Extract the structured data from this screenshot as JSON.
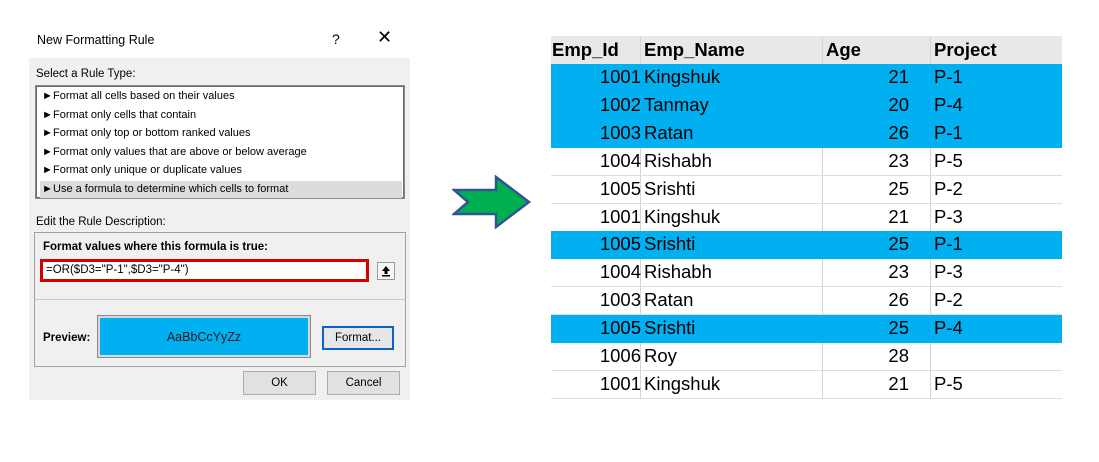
{
  "dialog": {
    "title": "New Formatting Rule",
    "help_label": "?",
    "close_label": "✕",
    "select_rule_type_label": "Select a Rule Type:",
    "rule_types": [
      {
        "label": "Format all cells based on their values",
        "selected": false
      },
      {
        "label": "Format only cells that contain",
        "selected": false
      },
      {
        "label": "Format only top or bottom ranked values",
        "selected": false
      },
      {
        "label": "Format only values that are above or below average",
        "selected": false
      },
      {
        "label": "Format only unique or duplicate values",
        "selected": false
      },
      {
        "label": "Use a formula to determine which cells to format",
        "selected": true
      }
    ],
    "rule_arrow": "►",
    "edit_description_label": "Edit the Rule Description:",
    "formula_heading": "Format values where this formula is true:",
    "formula_value": "=OR($D3=\"P-1\",$D3=\"P-4\")",
    "collapse_icon": "collapse-dialog-icon",
    "preview_label": "Preview:",
    "preview_text": "AaBbCcYyZz",
    "preview_color": "#00b0f0",
    "format_button": "Format...",
    "ok_button": "OK",
    "cancel_button": "Cancel"
  },
  "arrow": {
    "icon": "right-arrow-icon",
    "fill": "#00b050",
    "stroke": "#2f5597"
  },
  "table": {
    "headers": [
      "Emp_Id",
      "Emp_Name",
      "Age",
      "Project"
    ],
    "highlight_color": "#00b0f0",
    "rows": [
      {
        "id": "1001",
        "name": "Kingshuk",
        "age": "21",
        "project": "P-1",
        "highlight": true
      },
      {
        "id": "1002",
        "name": "Tanmay",
        "age": "20",
        "project": "P-4",
        "highlight": true
      },
      {
        "id": "1003",
        "name": "Ratan",
        "age": "26",
        "project": "P-1",
        "highlight": true
      },
      {
        "id": "1004",
        "name": "Rishabh",
        "age": "23",
        "project": "P-5",
        "highlight": false
      },
      {
        "id": "1005",
        "name": "Srishti",
        "age": "25",
        "project": "P-2",
        "highlight": false
      },
      {
        "id": "1001",
        "name": "Kingshuk",
        "age": "21",
        "project": "P-3",
        "highlight": false
      },
      {
        "id": "1005",
        "name": "Srishti",
        "age": "25",
        "project": "P-1",
        "highlight": true
      },
      {
        "id": "1004",
        "name": "Rishabh",
        "age": "23",
        "project": "P-3",
        "highlight": false
      },
      {
        "id": "1003",
        "name": "Ratan",
        "age": "26",
        "project": "P-2",
        "highlight": false
      },
      {
        "id": "1005",
        "name": "Srishti",
        "age": "25",
        "project": "P-4",
        "highlight": true
      },
      {
        "id": "1006",
        "name": "Roy",
        "age": "28",
        "project": "",
        "highlight": false
      },
      {
        "id": "1001",
        "name": "Kingshuk",
        "age": "21",
        "project": "P-5",
        "highlight": false
      }
    ]
  }
}
